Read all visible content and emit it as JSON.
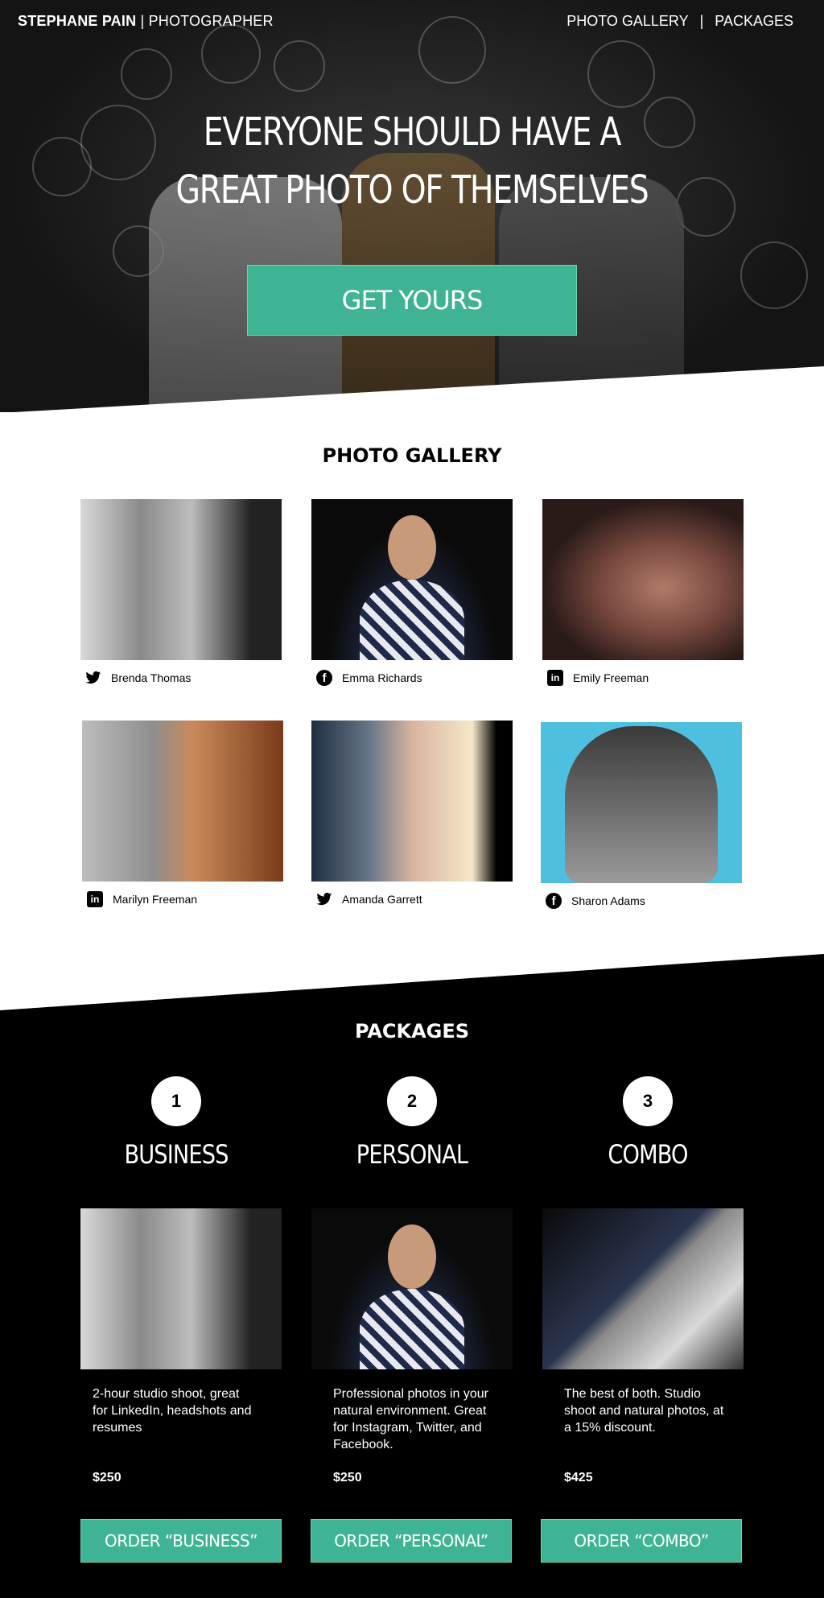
{
  "header": {
    "brand_name": "STEPHANE PAIN",
    "brand_role": "| PHOTOGRAPHER",
    "nav": [
      {
        "label": "PHOTO GALLERY"
      },
      {
        "label": "|"
      },
      {
        "label": "PACKAGES"
      }
    ]
  },
  "hero": {
    "title_line1": "EVERYONE SHOULD HAVE A",
    "title_line2": "GREAT PHOTO OF THEMSELVES",
    "cta_label": "GET YOURS"
  },
  "gallery": {
    "title": "PHOTO GALLERY",
    "items": [
      {
        "name": "Brenda Thomas",
        "icon": "twitter-icon"
      },
      {
        "name": "Emma Richards",
        "icon": "facebook-icon"
      },
      {
        "name": "Emily Freeman",
        "icon": "linkedin-icon"
      },
      {
        "name": "Marilyn Freeman",
        "icon": "linkedin-icon"
      },
      {
        "name": "Amanda Garrett",
        "icon": "twitter-icon"
      },
      {
        "name": "Sharon Adams",
        "icon": "facebook-icon"
      }
    ]
  },
  "packages": {
    "title": "PACKAGES",
    "items": [
      {
        "number": "1",
        "name": "BUSINESS",
        "description": "2-hour studio shoot, great for LinkedIn, headshots and resumes",
        "price": "$250",
        "order_label": "ORDER “BUSINESS”"
      },
      {
        "number": "2",
        "name": "PERSONAL",
        "description": "Professional photos in your natural environment. Great for Instagram, Twitter, and Facebook.",
        "price": "$250",
        "order_label": "ORDER “PERSONAL”"
      },
      {
        "number": "3",
        "name": "COMBO",
        "description": "The best of both. Studio shoot and natural photos, at a 15% discount.",
        "price": "$425",
        "order_label": "ORDER “COMBO”"
      }
    ]
  },
  "colors": {
    "accent": "#3fb495",
    "dark": "#000000",
    "light": "#ffffff"
  }
}
